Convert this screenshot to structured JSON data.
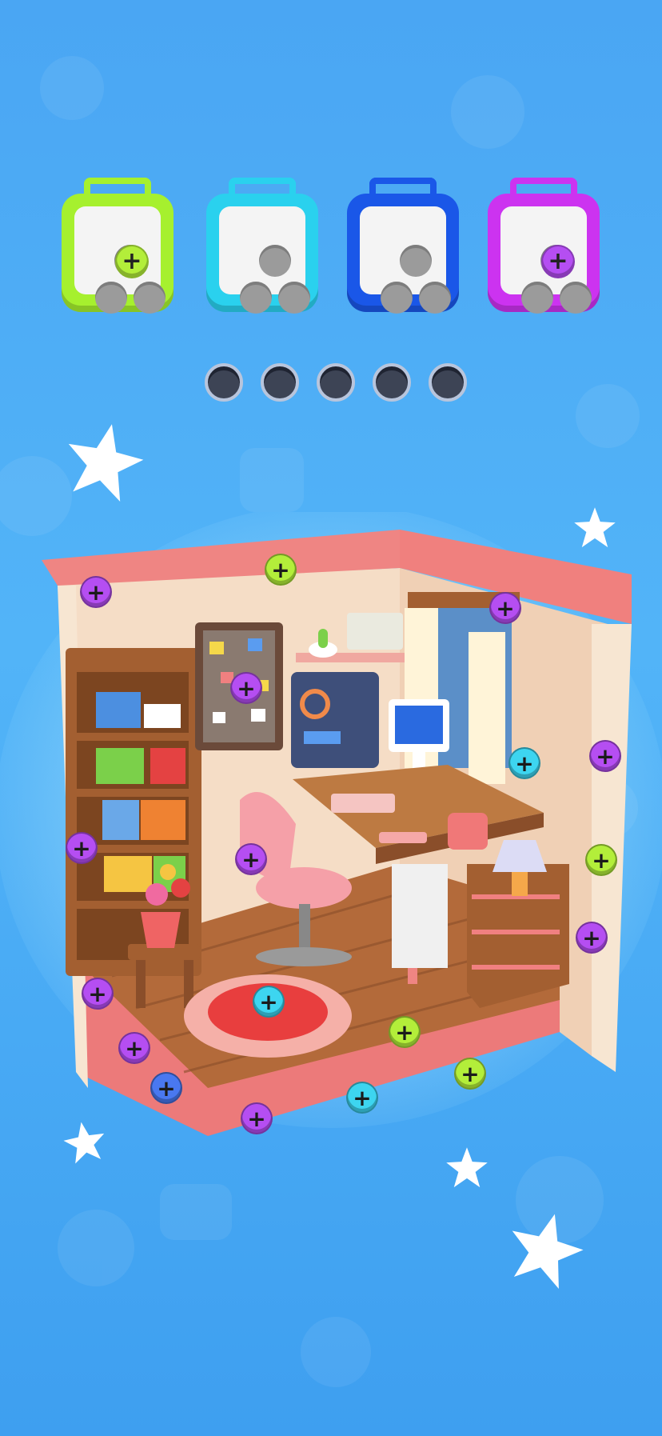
{
  "colors": {
    "background": "#4aa6f3",
    "lime": "#a6f02e",
    "cyan": "#2ad1ee",
    "blue": "#1a57e8",
    "magenta": "#cc33f0",
    "screw_lime": "#b3ee3a",
    "screw_cyan": "#3dd5f0",
    "screw_purple": "#b54ef2",
    "screw_blue": "#4978f0"
  },
  "toolboxes": [
    {
      "color": "lime",
      "slots_total": 3,
      "slots_filled": 1,
      "filled_screw": "lime",
      "pin_glyph": "+"
    },
    {
      "color": "cyan",
      "slots_total": 3,
      "slots_filled": 0
    },
    {
      "color": "blue",
      "slots_total": 3,
      "slots_filled": 0
    },
    {
      "color": "magenta",
      "slots_total": 3,
      "slots_filled": 1,
      "filled_screw": "purple",
      "pin_glyph": "+"
    }
  ],
  "holding_slots": {
    "total": 5,
    "filled": 0
  },
  "screws": [
    {
      "color": "purple",
      "glyph": "+"
    },
    {
      "color": "lime",
      "glyph": "+"
    },
    {
      "color": "purple",
      "glyph": "+"
    },
    {
      "color": "purple",
      "glyph": "+"
    },
    {
      "color": "cyan",
      "glyph": "+"
    },
    {
      "color": "purple",
      "glyph": "+"
    },
    {
      "color": "lime",
      "glyph": "+"
    },
    {
      "color": "purple",
      "glyph": "+"
    },
    {
      "color": "purple",
      "glyph": "+"
    },
    {
      "color": "purple",
      "glyph": "+"
    },
    {
      "color": "cyan",
      "glyph": "+"
    },
    {
      "color": "lime",
      "glyph": "+"
    },
    {
      "color": "purple",
      "glyph": "+"
    },
    {
      "color": "purple",
      "glyph": "+"
    },
    {
      "color": "blue",
      "glyph": "+"
    },
    {
      "color": "purple",
      "glyph": "+"
    },
    {
      "color": "cyan",
      "glyph": "+"
    },
    {
      "color": "lime",
      "glyph": "+"
    }
  ],
  "scene": {
    "name_icon": "study-room-diorama"
  }
}
